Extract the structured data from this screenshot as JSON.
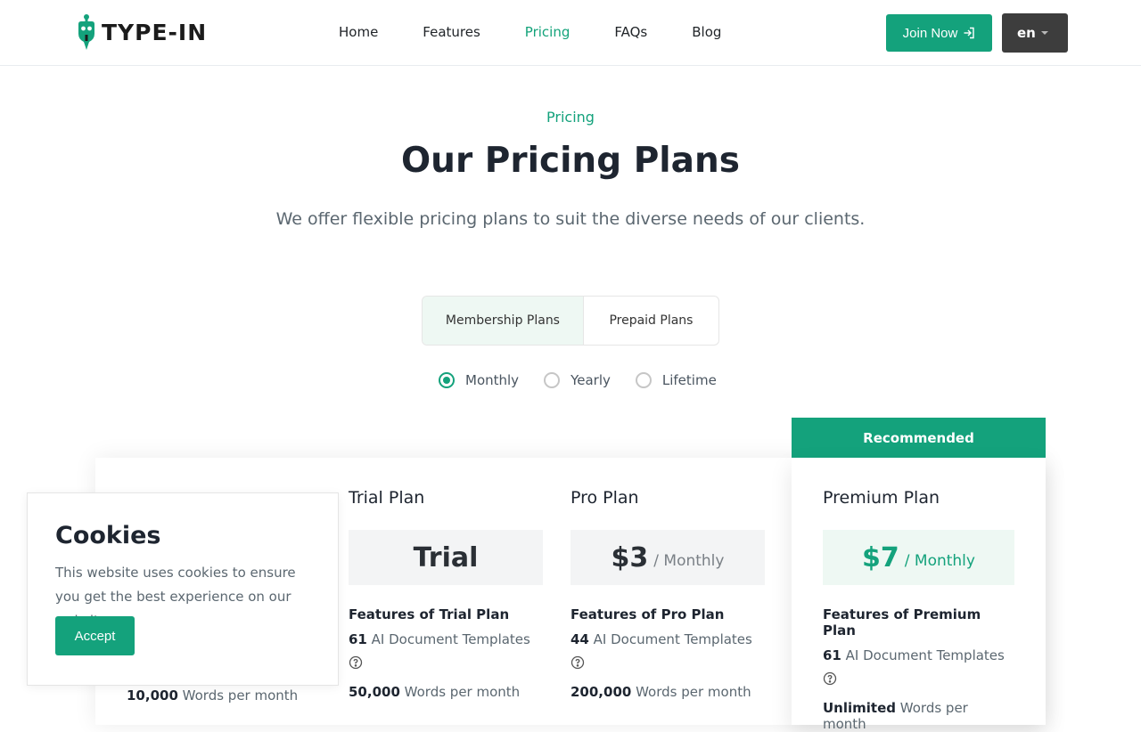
{
  "brand": {
    "logo_text": "TYPE-IN",
    "accent": "#14a27c"
  },
  "nav": {
    "items": [
      {
        "label": "Home",
        "active": false
      },
      {
        "label": "Features",
        "active": false
      },
      {
        "label": "Pricing",
        "active": true
      },
      {
        "label": "FAQs",
        "active": false
      },
      {
        "label": "Blog",
        "active": false
      }
    ],
    "join_label": "Join Now",
    "join_icon": "sign-in-icon",
    "language": "en"
  },
  "hero": {
    "eyebrow": "Pricing",
    "title": "Our Pricing Plans",
    "subtitle": "We offer flexible pricing plans to suit the diverse needs of our clients."
  },
  "plan_types": [
    {
      "label": "Membership Plans",
      "active": true
    },
    {
      "label": "Prepaid Plans",
      "active": false
    }
  ],
  "billing": [
    {
      "label": "Monthly",
      "checked": true
    },
    {
      "label": "Yearly",
      "checked": false
    },
    {
      "label": "Lifetime",
      "checked": false
    }
  ],
  "recommended_label": "Recommended",
  "free_plan": {
    "words_value": "10,000",
    "words_suffix": "Words per month"
  },
  "plans": [
    {
      "name": "Trial Plan",
      "price": "Trial",
      "period": "",
      "features_prefix": "Features of",
      "features_plan": "Trial Plan",
      "templates_count": "61",
      "templates_label": "AI Document Templates",
      "words_value": "50,000",
      "words_suffix": "Words per month"
    },
    {
      "name": "Pro Plan",
      "price": "$3",
      "period": "/ Monthly",
      "features_prefix": "Features of",
      "features_plan": "Pro Plan",
      "templates_count": "44",
      "templates_label": "AI Document Templates",
      "words_value": "200,000",
      "words_suffix": "Words per month"
    },
    {
      "name": "Premium Plan",
      "price": "$7",
      "period": "/ Monthly",
      "features_prefix": "Features of",
      "features_plan": "Premium Plan",
      "templates_count": "61",
      "templates_label": "AI Document Templates",
      "words_value": "Unlimited",
      "words_suffix": "Words per month"
    }
  ],
  "cookie": {
    "title": "Cookies",
    "text": "This website uses cookies to ensure you get the best experience on our website.",
    "accept_label": "Accept"
  }
}
